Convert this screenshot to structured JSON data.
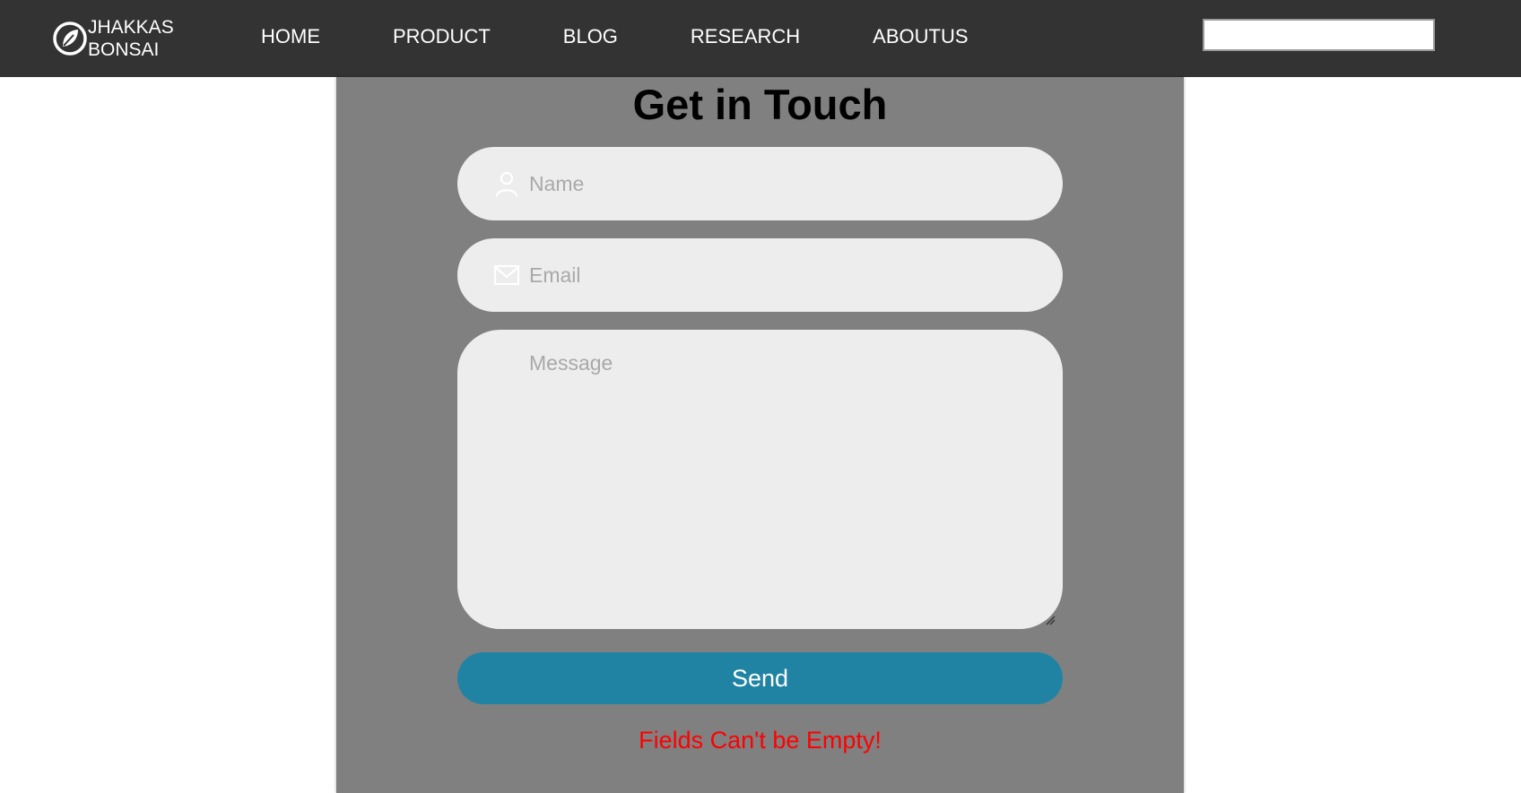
{
  "brand": {
    "name": "JHAKKAS\nBONSAI",
    "logo_icon": "leaf-circle-icon"
  },
  "nav": {
    "items": [
      {
        "label": "HOME"
      },
      {
        "label": "PRODUCT"
      },
      {
        "label": "BLOG"
      },
      {
        "label": "RESEARCH"
      },
      {
        "label": "ABOUTUS"
      }
    ],
    "search": {
      "value": "",
      "placeholder": ""
    }
  },
  "contact": {
    "title": "Get in Touch",
    "name_field": {
      "placeholder": "Name",
      "value": "",
      "icon": "user-icon"
    },
    "email_field": {
      "placeholder": "Email",
      "value": "",
      "icon": "envelope-icon"
    },
    "message_field": {
      "placeholder": "Message",
      "value": ""
    },
    "send_label": "Send",
    "error": "Fields Can't be Empty!"
  },
  "colors": {
    "navbar_bg": "#333333",
    "panel_bg": "#808080",
    "field_bg": "#ededed",
    "button_bg": "#2083a4",
    "error_text": "#ff0000"
  }
}
